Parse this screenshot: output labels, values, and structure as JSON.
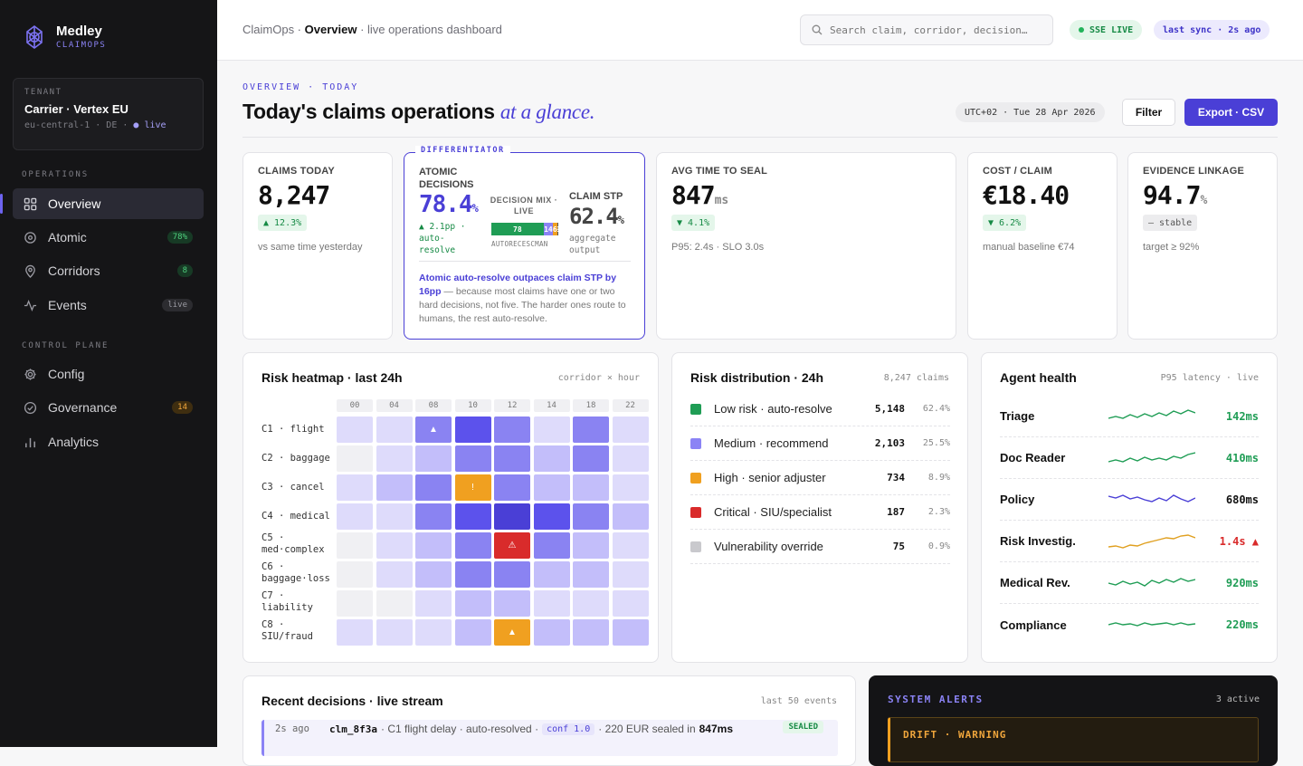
{
  "brand": {
    "name": "Medley",
    "sub": "CLAIMOPS"
  },
  "tenant": {
    "label": "TENANT",
    "name": "Carrier · Vertex EU",
    "region": "eu-central-1 · DE ·",
    "status": "live"
  },
  "sidebar": {
    "operations_label": "OPERATIONS",
    "control_label": "CONTROL PLANE",
    "items": [
      {
        "label": "Overview",
        "badge": ""
      },
      {
        "label": "Atomic",
        "badge": "78%"
      },
      {
        "label": "Corridors",
        "badge": "8"
      },
      {
        "label": "Events",
        "badge": "live"
      },
      {
        "label": "Config",
        "badge": ""
      },
      {
        "label": "Governance",
        "badge": "14"
      },
      {
        "label": "Analytics",
        "badge": ""
      }
    ]
  },
  "topbar": {
    "crumb_root": "ClaimOps ·",
    "crumb_current": "Overview",
    "crumb_tail": "· live operations dashboard",
    "search_placeholder": "Search claim, corridor, decision…",
    "sse": "SSE LIVE",
    "sync": "last sync · 2s ago"
  },
  "header": {
    "eyebrow": "OVERVIEW · TODAY",
    "title": "Today's claims operations",
    "title_em": "at a glance.",
    "date": "UTC+02 · Tue 28 Apr 2026",
    "filter": "Filter",
    "export": "Export · CSV"
  },
  "kpis": {
    "claims": {
      "label": "CLAIMS TODAY",
      "value": "8,247",
      "delta": "▲ 12.3%",
      "note": "vs same time yesterday"
    },
    "atomic": {
      "tag": "DIFFERENTIATOR",
      "label": "ATOMIC DECISIONS",
      "value": "78.4",
      "unit": "%",
      "delta": "▲ 2.1pp · auto-resolve",
      "mix_label": "DECISION MIX · LIVE",
      "mix": [
        {
          "label": "AUTO",
          "value": "78",
          "pct": 78
        },
        {
          "label": "REC",
          "value": "14",
          "pct": 14
        },
        {
          "label": "ESC",
          "value": "6",
          "pct": 6
        },
        {
          "label": "MAN",
          "value": "2",
          "pct": 2
        }
      ],
      "mix_axis": "AUTORECESCMAN",
      "stp_label": "CLAIM STP",
      "stp_value": "62.4",
      "stp_unit": "%",
      "stp_note": "aggregate output",
      "insight_strong": "Atomic auto-resolve outpaces claim STP by 16pp",
      "insight_rest": " — because most claims have one or two hard decisions, not five. The harder ones route to humans, the rest auto-resolve."
    },
    "seal": {
      "label": "AVG TIME TO SEAL",
      "value": "847",
      "unit": "ms",
      "delta": "▼ 4.1%",
      "note": "P95: 2.4s · SLO 3.0s"
    },
    "cost": {
      "label": "COST / CLAIM",
      "value": "€18.40",
      "delta": "▼ 6.2%",
      "note": "manual baseline €74"
    },
    "evidence": {
      "label": "EVIDENCE LINKAGE",
      "value": "94.7",
      "unit": "%",
      "delta": "— stable",
      "note": "target ≥ 92%"
    }
  },
  "heatmap": {
    "title": "Risk heatmap · last 24h",
    "sub": "corridor × hour",
    "hours": [
      "00",
      "04",
      "08",
      "10",
      "12",
      "14",
      "18",
      "22"
    ],
    "rows": [
      {
        "label": "C1 · flight",
        "levels": [
          1,
          1,
          3,
          4,
          3,
          1,
          3,
          1
        ],
        "marks": [
          "",
          "",
          "▲",
          "",
          "",
          "",
          "",
          ""
        ]
      },
      {
        "label": "C2 · baggage",
        "levels": [
          0,
          1,
          2,
          3,
          3,
          2,
          3,
          1
        ],
        "marks": [
          "",
          "",
          "",
          "",
          "",
          "",
          "",
          ""
        ]
      },
      {
        "label": "C3 · cancel",
        "levels": [
          1,
          2,
          3,
          "w",
          3,
          2,
          2,
          1
        ],
        "marks": [
          "",
          "",
          "",
          "!",
          "",
          "",
          "",
          ""
        ]
      },
      {
        "label": "C4 · medical",
        "levels": [
          1,
          1,
          3,
          4,
          5,
          4,
          3,
          2
        ],
        "marks": [
          "",
          "",
          "",
          "",
          "",
          "",
          "",
          ""
        ]
      },
      {
        "label": "C5 · med·complex",
        "levels": [
          0,
          1,
          2,
          3,
          "c",
          3,
          2,
          1
        ],
        "marks": [
          "",
          "",
          "",
          "",
          "⚠",
          "",
          "",
          ""
        ]
      },
      {
        "label": "C6 · baggage·loss",
        "levels": [
          0,
          1,
          2,
          3,
          3,
          2,
          2,
          1
        ],
        "marks": [
          "",
          "",
          "",
          "",
          "",
          "",
          "",
          ""
        ]
      },
      {
        "label": "C7 · liability",
        "levels": [
          0,
          0,
          1,
          2,
          2,
          1,
          1,
          1
        ],
        "marks": [
          "",
          "",
          "",
          "",
          "",
          "",
          "",
          ""
        ]
      },
      {
        "label": "C8 · SIU/fraud",
        "levels": [
          1,
          1,
          1,
          2,
          "w",
          2,
          2,
          2
        ],
        "marks": [
          "",
          "",
          "",
          "",
          "▲",
          "",
          "",
          ""
        ]
      }
    ]
  },
  "risk": {
    "title": "Risk distribution · 24h",
    "sub": "8,247 claims",
    "rows": [
      {
        "label": "Low risk · auto-resolve",
        "count": "5,148",
        "pct": "62.4%",
        "color": "#1f9d55"
      },
      {
        "label": "Medium · recommend",
        "count": "2,103",
        "pct": "25.5%",
        "color": "#8b83f5"
      },
      {
        "label": "High · senior adjuster",
        "count": "734",
        "pct": "8.9%",
        "color": "#f0a020"
      },
      {
        "label": "Critical · SIU/specialist",
        "count": "187",
        "pct": "2.3%",
        "color": "#d92b2b"
      },
      {
        "label": "Vulnerability override",
        "count": "75",
        "pct": "0.9%",
        "color": "#c9c9cd"
      }
    ]
  },
  "agents": {
    "title": "Agent health",
    "sub": "P95 latency · live",
    "rows": [
      {
        "name": "Triage",
        "value": "142ms",
        "color": "#1f9d55",
        "vcolor": "#1f9d55",
        "spark": "0,12 8,10 16,12 24,8 32,11 40,7 48,10 56,6 64,9 72,4 80,7 88,3 96,6"
      },
      {
        "name": "Doc Reader",
        "value": "410ms",
        "color": "#1f9d55",
        "vcolor": "#1f9d55",
        "spark": "0,14 8,12 16,14 24,10 32,13 40,9 48,12 56,10 64,12 72,8 80,10 88,6 96,4"
      },
      {
        "name": "Policy",
        "value": "680ms",
        "color": "#4a3fd6",
        "vcolor": "#111",
        "spark": "0,6 8,8 16,5 24,9 32,7 40,10 48,12 56,8 64,11 72,5 80,9 88,12 96,8"
      },
      {
        "name": "Risk Investig.",
        "value": "1.4s ▲",
        "color": "#e0a020",
        "vcolor": "#d92b2b",
        "spark": "0,16 8,15 16,17 24,14 32,15 40,12 48,10 56,8 64,6 72,7 80,4 88,3 96,6"
      },
      {
        "name": "Medical Rev.",
        "value": "920ms",
        "color": "#1f9d55",
        "vcolor": "#1f9d55",
        "spark": "0,10 8,12 16,8 24,11 32,9 40,13 48,7 56,10 64,6 72,9 80,5 88,8 96,6"
      },
      {
        "name": "Compliance",
        "value": "220ms",
        "color": "#1f9d55",
        "vcolor": "#1f9d55",
        "spark": "0,10 8,8 16,10 24,9 32,11 40,8 48,10 56,9 64,8 72,10 80,8 88,10 96,9"
      }
    ]
  },
  "recent": {
    "title": "Recent decisions · live stream",
    "sub": "last 50 events",
    "row": {
      "time": "2s ago",
      "id": "clm_8f3a",
      "text1": "· C1 flight delay · auto-resolved ·",
      "conf": "conf 1.0",
      "text2": "· 220 EUR sealed in",
      "ms": "847ms",
      "badge": "SEALED"
    }
  },
  "alerts": {
    "title": "SYSTEM ALERTS",
    "sub": "3 active",
    "first": "DRIFT · WARNING"
  }
}
